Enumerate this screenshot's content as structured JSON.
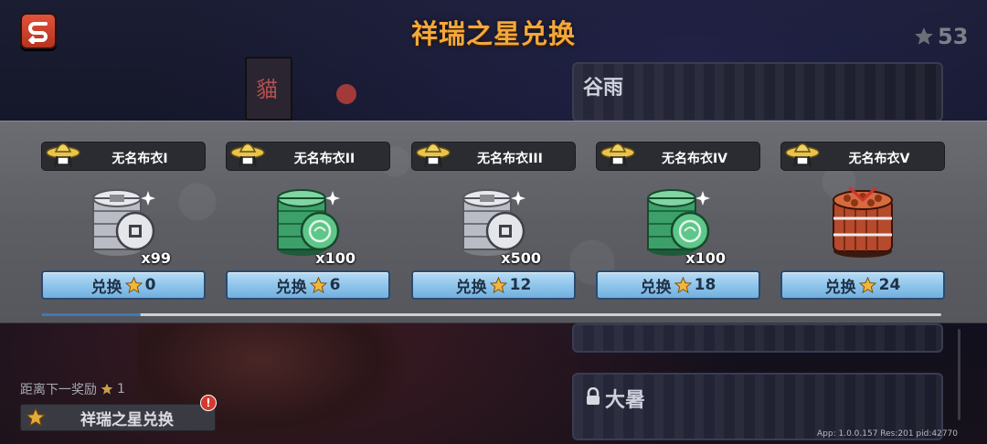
{
  "header": {
    "title": "祥瑞之星兑换",
    "star_total": "53"
  },
  "background": {
    "banner_char": "貓",
    "side_cards": [
      {
        "title": "谷雨",
        "locked": false
      },
      {
        "title": "大暑",
        "locked": true
      }
    ]
  },
  "rewards": [
    {
      "name": "无名布衣I",
      "icon": "silver-coin-stack-icon",
      "qty": "x99",
      "exchange_label": "兑换",
      "cost": "0"
    },
    {
      "name": "无名布衣II",
      "icon": "jade-coin-stack-icon",
      "qty": "x100",
      "exchange_label": "兑换",
      "cost": "6"
    },
    {
      "name": "无名布衣III",
      "icon": "silver-coin-stack-icon",
      "qty": "x500",
      "exchange_label": "兑换",
      "cost": "12"
    },
    {
      "name": "无名布衣IV",
      "icon": "jade-coin-stack-icon",
      "qty": "x100",
      "exchange_label": "兑换",
      "cost": "18"
    },
    {
      "name": "无名布衣V",
      "icon": "firecracker-bundle-icon",
      "qty": "",
      "exchange_label": "兑换",
      "cost": "24"
    }
  ],
  "progress": {
    "fraction": 0.11
  },
  "footer": {
    "next_reward_label": "距离下一奖励",
    "next_reward_stars": "1",
    "exchange_tab_label": "祥瑞之星兑换",
    "alert_mark": "!",
    "version": "App: 1.0.0.157 Res:201 pid:42770"
  },
  "colors": {
    "title": "#f4a83a",
    "button_blue": "#8cc3ea",
    "star_gold": "#f1b73a",
    "back_red": "#d0452f"
  }
}
